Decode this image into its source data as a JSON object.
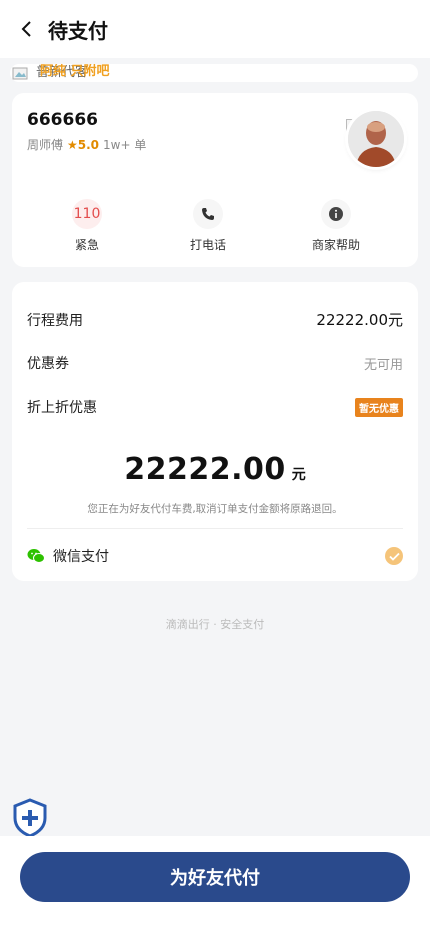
{
  "header": {
    "title": "待支付",
    "back_icon": "chevron-left-icon"
  },
  "notice": {
    "text": "普新代客",
    "tag": "阿纯 只附吧"
  },
  "driver": {
    "plate": "666666",
    "name": "周师傅",
    "rating": "★5.0",
    "orders": "1w+ 单",
    "avatar_icon": "driver-avatar"
  },
  "actions": [
    {
      "label": "紧急",
      "icon_text": "110",
      "icon": "emergency-110-icon"
    },
    {
      "label": "打电话",
      "icon": "phone-icon"
    },
    {
      "label": "商家帮助",
      "icon": "info-icon"
    }
  ],
  "fare": {
    "trip_fee_label": "行程费用",
    "trip_fee_value": "22222.00元",
    "coupon_label": "优惠券",
    "coupon_value": "无可用",
    "discount_label": "折上折优惠",
    "discount_badge": "暂无优惠",
    "total_amount": "22222.00",
    "total_unit": "元",
    "notice": "您正在为好友代付车费,取消订单支付金额将原路退回。"
  },
  "payment": {
    "method_label": "微信支付",
    "icon": "wechat-icon",
    "selected": true
  },
  "footer": {
    "note": "滴滴出行 · 安全支付"
  },
  "cta": {
    "label": "为好友代付"
  },
  "colors": {
    "primary": "#2a4a8c",
    "accent": "#e8831d",
    "check": "#f5c47a",
    "background": "#f4f5f7"
  }
}
